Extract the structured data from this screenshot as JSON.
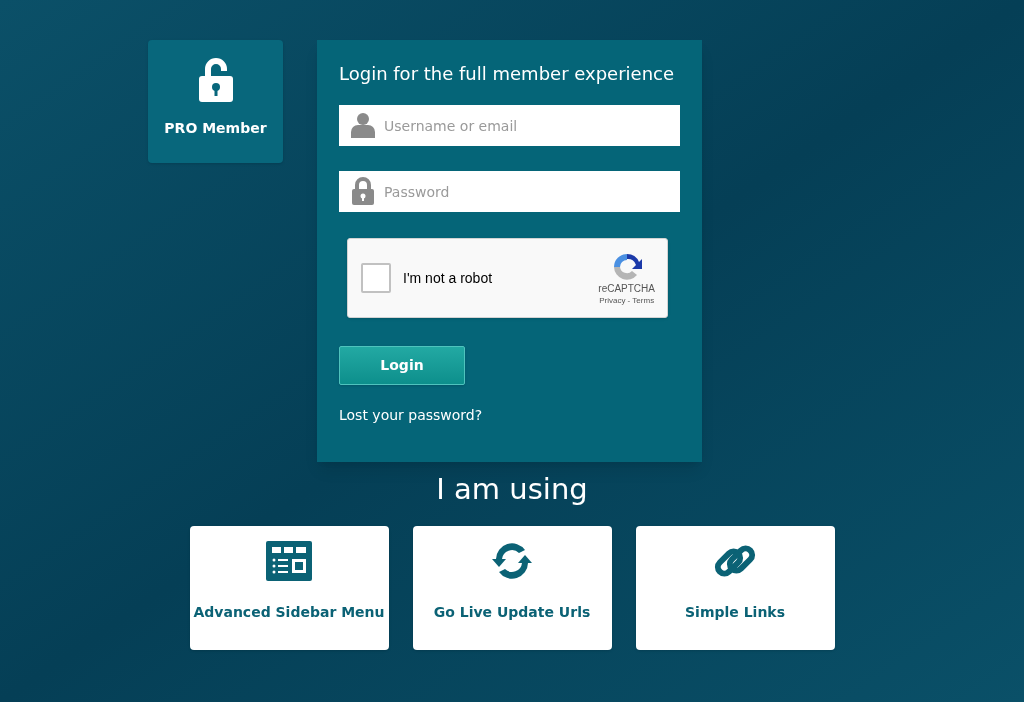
{
  "member_badge": {
    "label": "PRO Member"
  },
  "login": {
    "title": "Login for the full member experience",
    "username": {
      "placeholder": "Username or email"
    },
    "password": {
      "placeholder": "Password"
    },
    "captcha": {
      "label": "I'm not a robot",
      "checked": false,
      "brand": "reCAPTCHA",
      "privacy": "Privacy",
      "separator": " - ",
      "terms": "Terms"
    },
    "button": "Login",
    "lost_password": "Lost your password?"
  },
  "section_title": "I am using",
  "plugins": [
    {
      "kind": "sidebar",
      "label": "Advanced Sidebar Menu"
    },
    {
      "kind": "refresh",
      "label": "Go Live Update Urls"
    },
    {
      "kind": "link",
      "label": "Simple Links"
    }
  ]
}
